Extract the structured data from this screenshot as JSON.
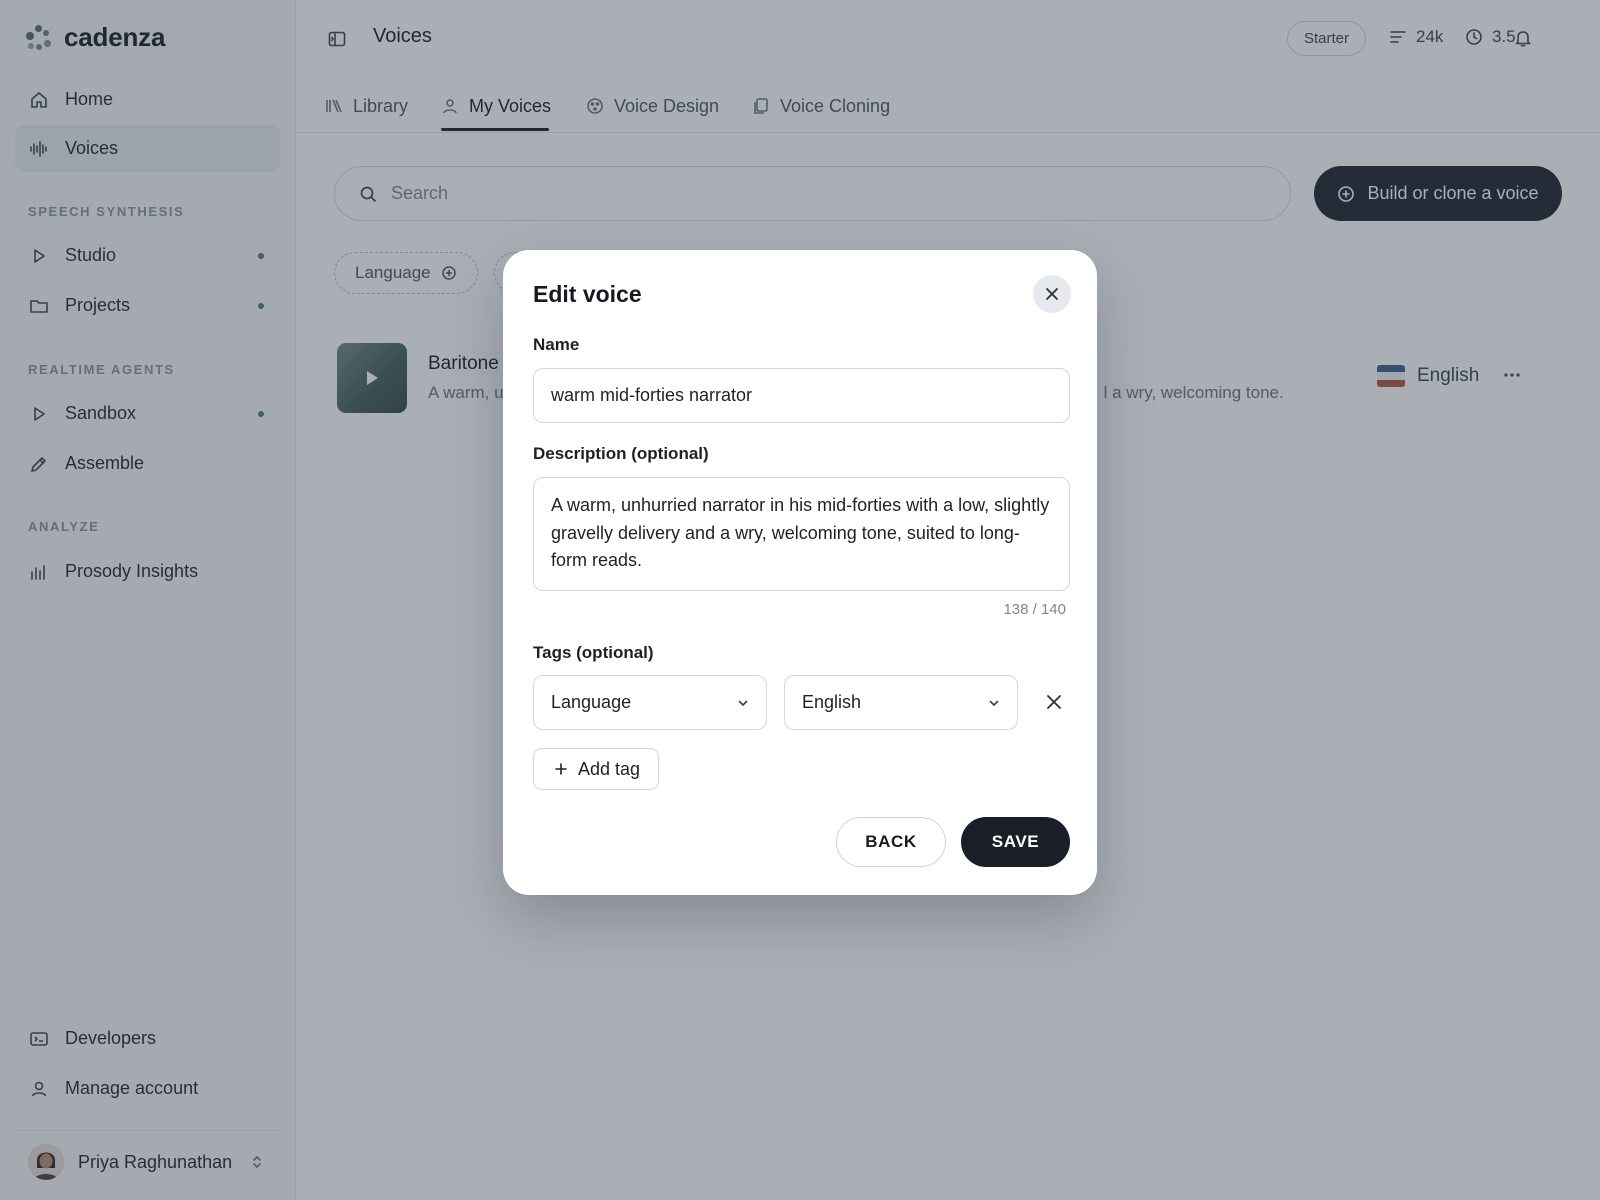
{
  "app": {
    "brand_name": "cadenza",
    "brand_color": "#4d6b63"
  },
  "sidebar": {
    "items_top": [
      {
        "label": "Home",
        "icon": "home-icon",
        "active": false
      },
      {
        "label": "Voices",
        "icon": "waveform-icon",
        "active": true
      }
    ],
    "section_speech": "SPEECH SYNTHESIS",
    "items_speech": [
      {
        "label": "Studio",
        "icon": "play-icon",
        "has_dot": true
      },
      {
        "label": "Projects",
        "icon": "folder-icon",
        "has_dot": true
      }
    ],
    "section_realtime": "REALTIME AGENTS",
    "items_realtime": [
      {
        "label": "Sandbox",
        "icon": "play-icon",
        "has_dot": true
      },
      {
        "label": "Assemble",
        "icon": "pencil-icon",
        "has_dot": false
      }
    ],
    "section_analyze": "ANALYZE",
    "items_analyze": [
      {
        "label": "Prosody Insights",
        "icon": "bar-chart-icon",
        "has_dot": false
      }
    ],
    "items_bottom": [
      {
        "label": "Developers",
        "icon": "terminal-icon"
      },
      {
        "label": "Manage account",
        "icon": "user-icon"
      }
    ],
    "user_name": "Priya Raghunathan"
  },
  "header": {
    "title": "Voices",
    "plan": "Starter",
    "characters": "24k",
    "minutes": "3.5"
  },
  "tabs": [
    {
      "label": "Library",
      "icon": "library-icon",
      "active": false
    },
    {
      "label": "My Voices",
      "icon": "user-icon",
      "active": true
    },
    {
      "label": "Voice Design",
      "icon": "palette-icon",
      "active": false
    },
    {
      "label": "Voice Cloning",
      "icon": "copy-icon",
      "active": false
    }
  ],
  "search": {
    "placeholder": "Search",
    "value": ""
  },
  "build_button": "Build or clone a voice",
  "filters": {
    "language": "Language"
  },
  "voice_row": {
    "name": "Baritone",
    "description_start": "A warm, u",
    "description_end": "l a wry, welcoming tone.",
    "language": "English"
  },
  "modal": {
    "title": "Edit voice",
    "name_label": "Name",
    "name_value": "warm mid-forties narrator",
    "description_label": "Description (optional)",
    "description_value": "A warm, unhurried narrator in his mid-forties with a low, slightly gravelly delivery and a wry, welcoming tone, suited to long-form reads.",
    "char_count": "138 / 140",
    "tags_label": "Tags (optional)",
    "tag_key": "Language",
    "tag_value": "English",
    "add_tag": "Add tag",
    "back": "BACK",
    "save": "SAVE"
  },
  "colors": {
    "primary_dark": "#1a1f27",
    "status_dot": "#4a7a6b",
    "overlay": "rgba(52, 62, 78, 0.42)"
  }
}
